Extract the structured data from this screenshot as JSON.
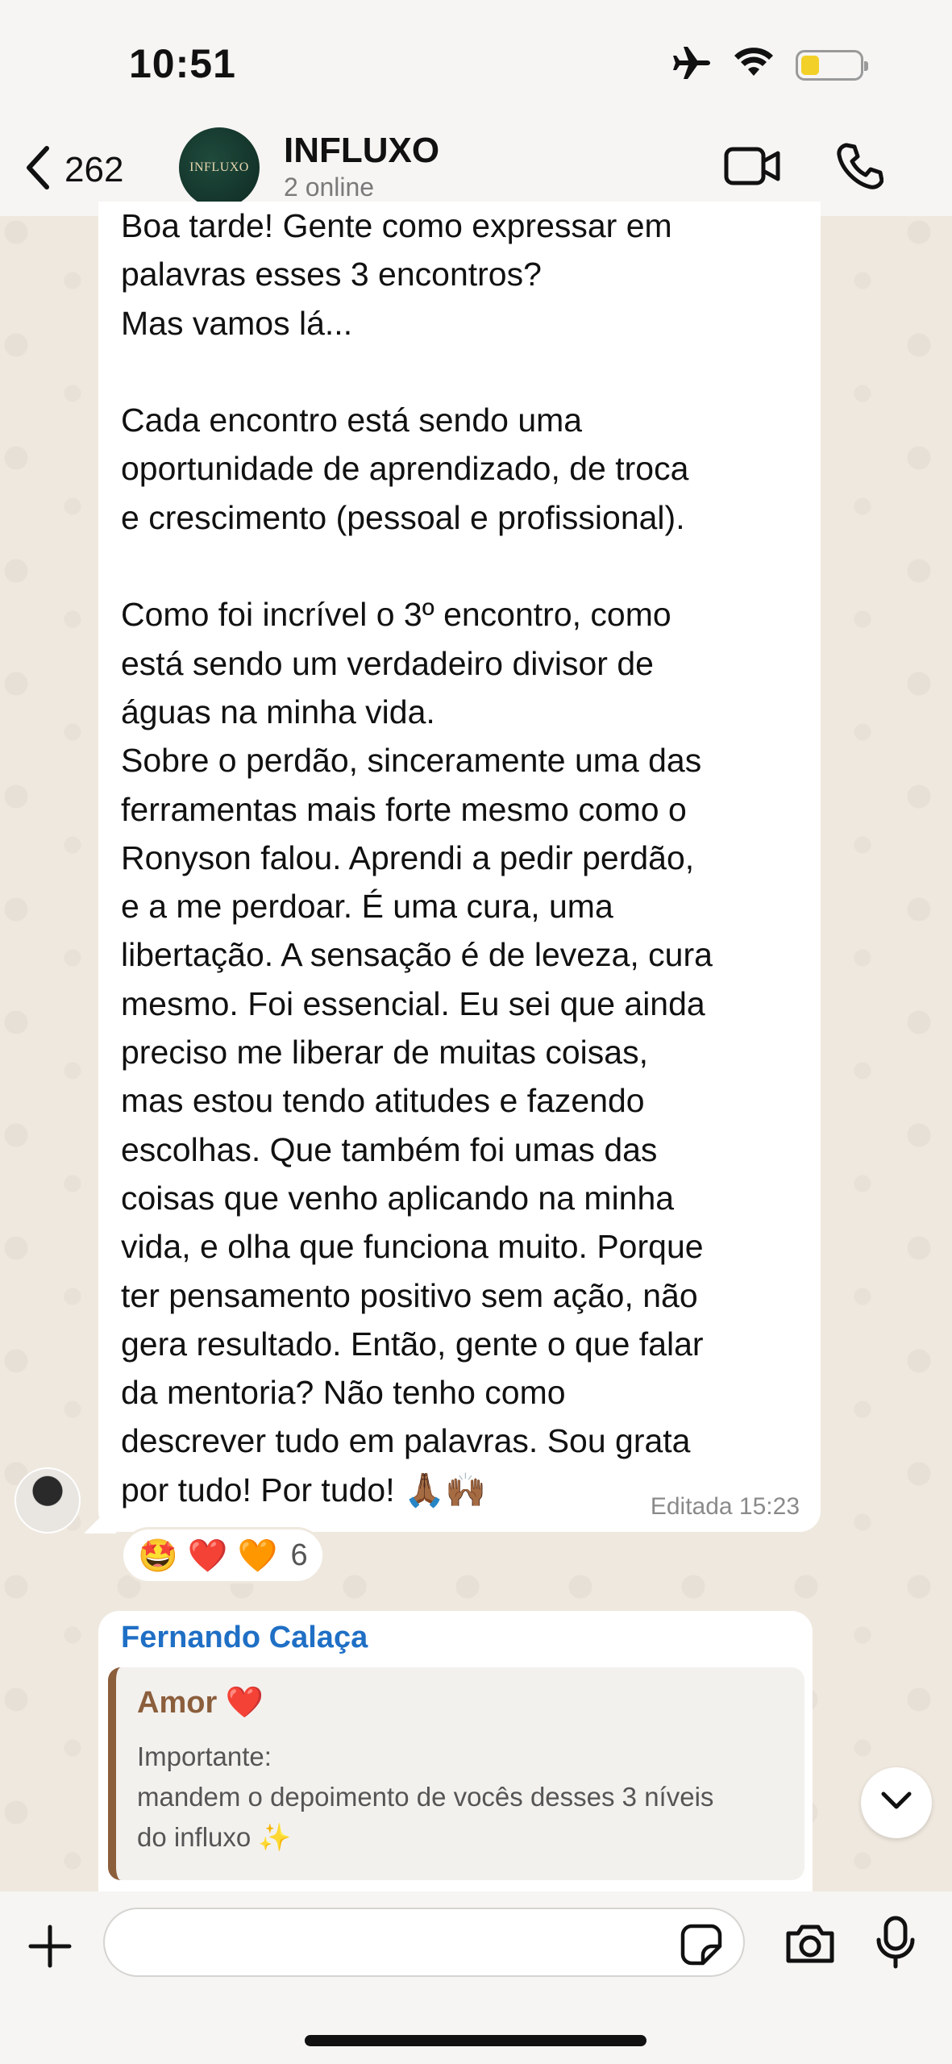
{
  "status_bar": {
    "time": "10:51",
    "icons": [
      "airplane-icon",
      "wifi-icon",
      "battery-icon"
    ],
    "battery_color": "#f3d027"
  },
  "header": {
    "back_count": "262",
    "group_name": "INFLUXO",
    "group_subtitle": "2 online",
    "avatar_logo_text": "INFLUXO",
    "actions": [
      "video-call-icon",
      "phone-icon"
    ]
  },
  "message": {
    "text": "Boa tarde! Gente como expressar em\npalavras esses 3 encontros?\nMas vamos lá...\n\nCada encontro está sendo uma\noportunidade de aprendizado, de troca\ne crescimento (pessoal e profissional).\n\nComo foi incrível o 3º encontro, como\nestá sendo um verdadeiro divisor de\náguas na minha vida.\nSobre o perdão, sinceramente uma das\nferramentas mais forte mesmo como o\nRonyson falou. Aprendi a pedir perdão,\ne a me perdoar. É uma cura, uma\nlibertação. A sensação é de leveza, cura\nmesmo. Foi essencial. Eu sei que ainda\npreciso me liberar de muitas coisas,\nmas estou tendo atitudes e fazendo\nescolhas. Que também foi umas das\ncoisas que venho aplicando na minha\nvida, e olha que funciona muito. Porque\nter pensamento positivo sem ação, não\ngera resultado. Então, gente o que falar\nda mentoria? Não tenho como\ndescrever tudo em palavras. Sou grata\npor tudo! Por tudo! 🙏🏾🙌🏾",
    "meta": "Editada 15:23",
    "reactions": [
      "🤩",
      "❤️",
      "🧡"
    ],
    "reaction_count": "6"
  },
  "message2": {
    "sender": "Fernando Calaça",
    "sender_color": "#1f6fc5",
    "quote_name": "Amor ❤️",
    "quote_color": "#8b5e3c",
    "quote_body": "Importante:\nmandem o depoimento de vocês desses 3 níveis\ndo influxo ✨"
  },
  "composer": {
    "placeholder": ""
  }
}
